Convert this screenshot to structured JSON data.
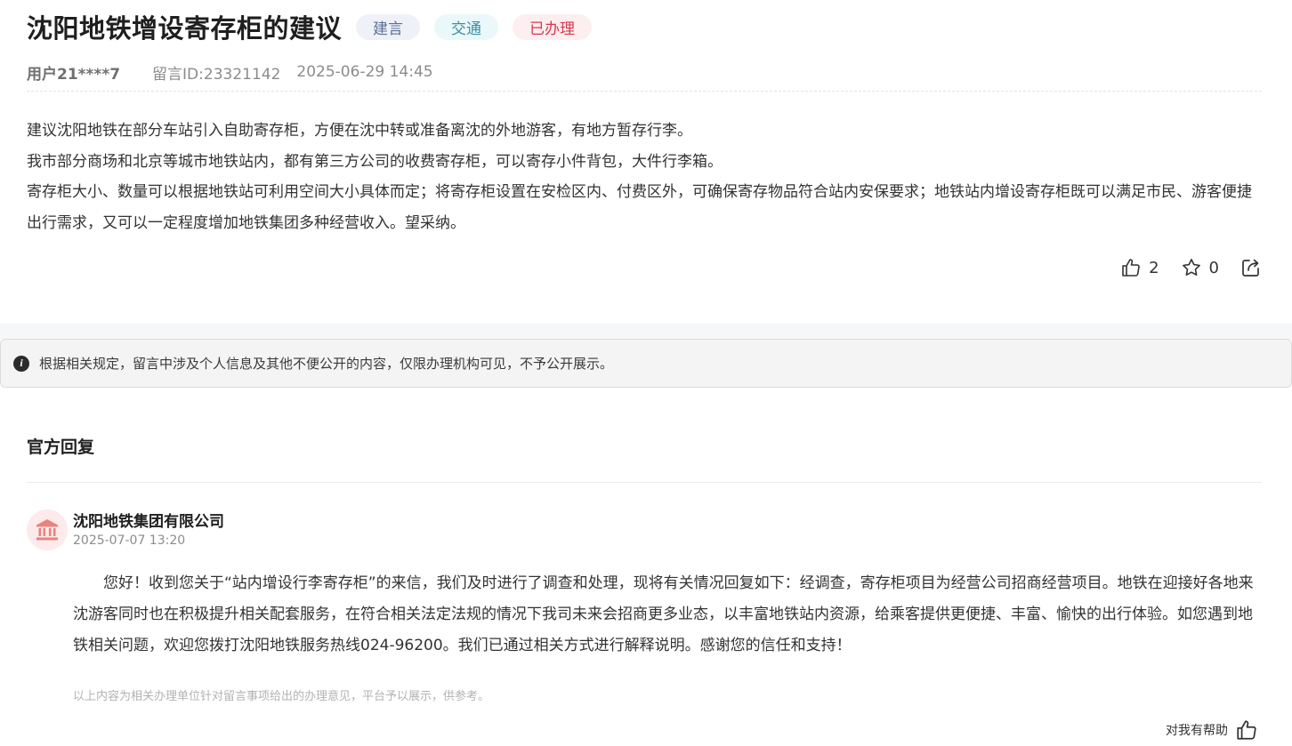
{
  "post": {
    "title": "沈阳地铁增设寄存柜的建议",
    "tags": [
      "建言",
      "交通",
      "已办理"
    ],
    "user": "用户21****7",
    "message_id": "留言ID:23321142",
    "datetime": "2025-06-29 14:45",
    "content": [
      "建议沈阳地铁在部分车站引入自助寄存柜，方便在沈中转或准备离沈的外地游客，有地方暂存行李。",
      "我市部分商场和北京等城市地铁站内，都有第三方公司的收费寄存柜，可以寄存小件背包，大件行李箱。",
      "寄存柜大小、数量可以根据地铁站可利用空间大小具体而定；将寄存柜设置在安检区内、付费区外，可确保寄存物品符合站内安保要求；地铁站内增设寄存柜既可以满足市民、游客便捷出行需求，又可以一定程度增加地铁集团多种经营收入。望采纳。"
    ],
    "like_count": "2",
    "favorite_count": "0"
  },
  "notice": {
    "text": "根据相关规定，留言中涉及个人信息及其他不便公开的内容，仅限办理机构可见，不予公开展示。"
  },
  "reply": {
    "heading": "官方回复",
    "org_name": "沈阳地铁集团有限公司",
    "datetime": "2025-07-07 13:20",
    "body": "您好！收到您关于“站内增设行李寄存柜”的来信，我们及时进行了调查和处理，现将有关情况回复如下：经调查，寄存柜项目为经营公司招商经营项目。地铁在迎接好各地来沈游客同时也在积极提升相关配套服务，在符合相关法定法规的情况下我司未来会招商更多业态，以丰富地铁站内资源，给乘客提供更便捷、丰富、愉快的出行体验。如您遇到地铁相关问题，欢迎您拨打沈阳地铁服务热线024-96200。我们已通过相关方式进行解释说明。感谢您的信任和支持！",
    "disclaimer": "以上内容为相关办理单位针对留言事项给出的办理意见，平台予以展示，供参考。",
    "helpful_label": "对我有帮助"
  },
  "icons": {
    "like": "thumbs-up-icon",
    "favorite": "star-icon",
    "share": "share-icon",
    "info": "info-icon",
    "org": "government-building-icon"
  },
  "colors": {
    "tag_advice_bg": "#eef1f7",
    "tag_traffic_bg": "#eaf8f9",
    "tag_done_bg": "#fdeef0",
    "tag_done_text": "#d9364b",
    "org_icon": "#e8837f"
  }
}
